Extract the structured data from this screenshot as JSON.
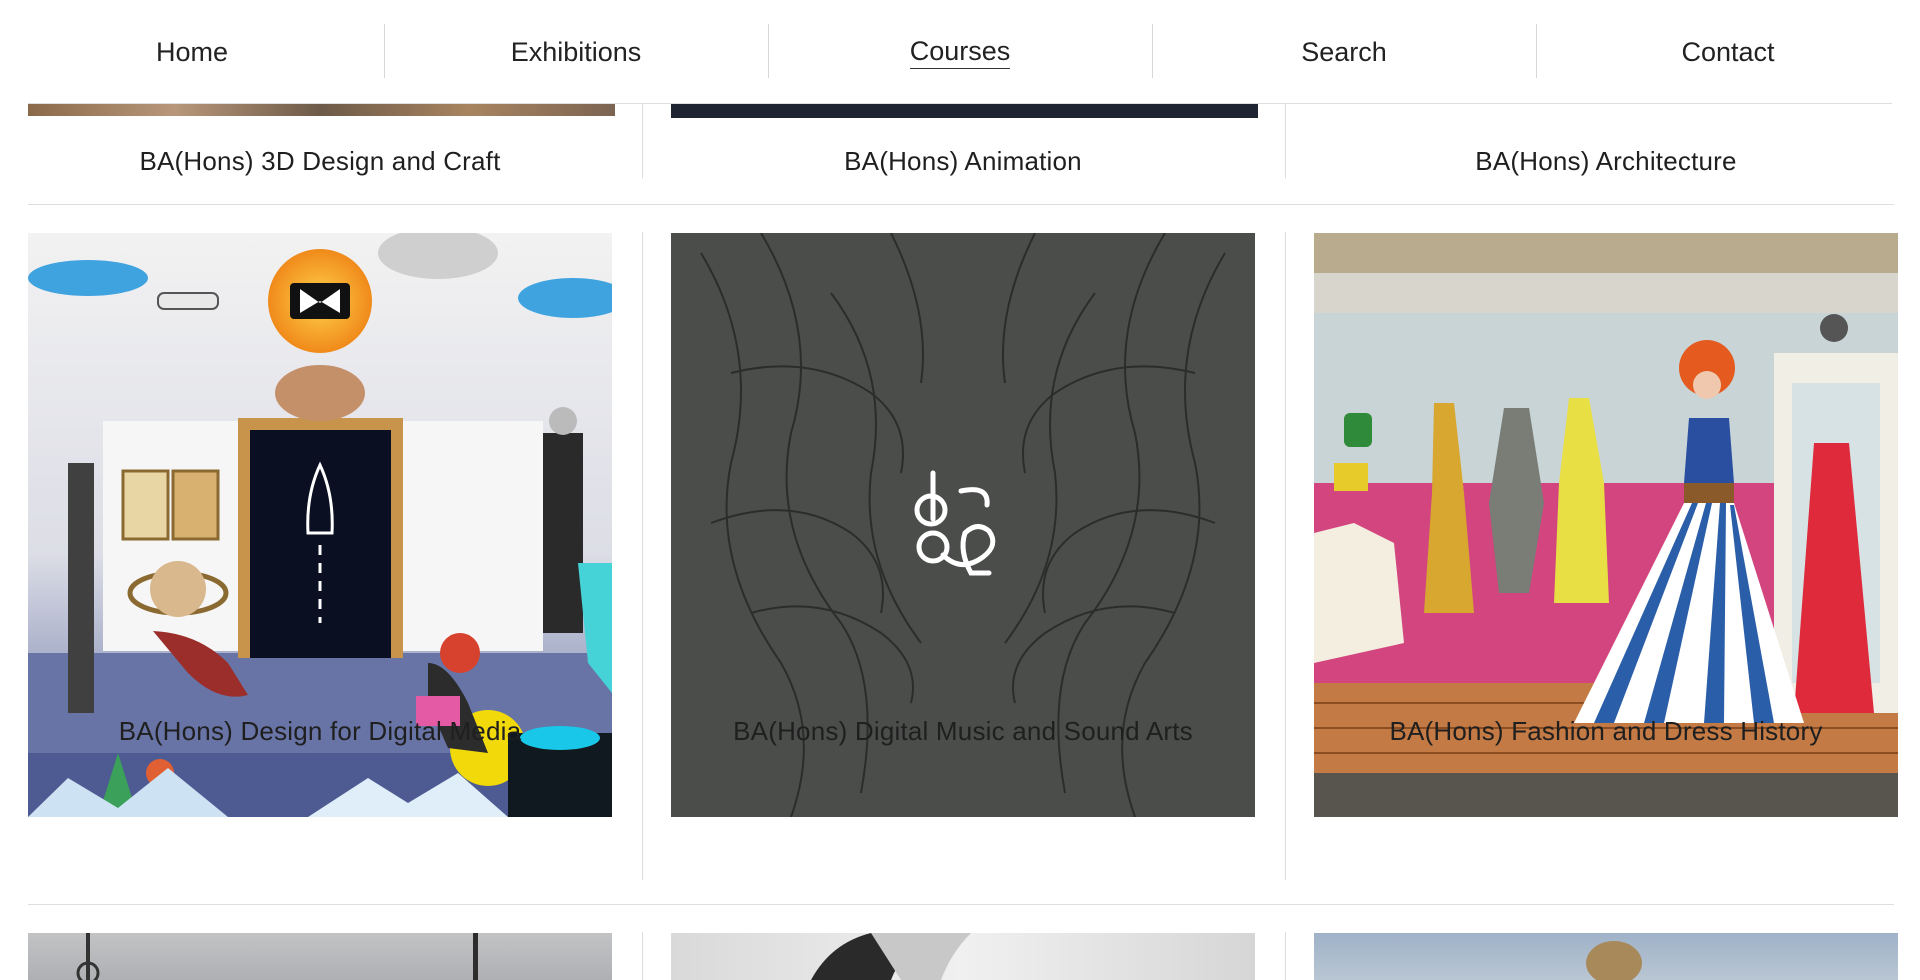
{
  "nav": {
    "items": [
      {
        "label": "Home",
        "active": false
      },
      {
        "label": "Exhibitions",
        "active": false
      },
      {
        "label": "Courses",
        "active": true
      },
      {
        "label": "Search",
        "active": false
      },
      {
        "label": "Contact",
        "active": false
      }
    ]
  },
  "courses": {
    "row1": [
      {
        "title": "BA(Hons) 3D Design and Craft"
      },
      {
        "title": "BA(Hons) Animation"
      },
      {
        "title": "BA(Hons) Architecture"
      }
    ],
    "row2": [
      {
        "title": "BA(Hons) Design for Digital Media"
      },
      {
        "title": "BA(Hons) Digital Music and Sound Arts"
      },
      {
        "title": "BA(Hons) Fashion and Dress History"
      }
    ]
  },
  "colors": {
    "rule": "#dedede",
    "text": "#1f1f1f",
    "music_bg": "#4a4c4a",
    "fashion_wall": "#c9c4b2"
  }
}
